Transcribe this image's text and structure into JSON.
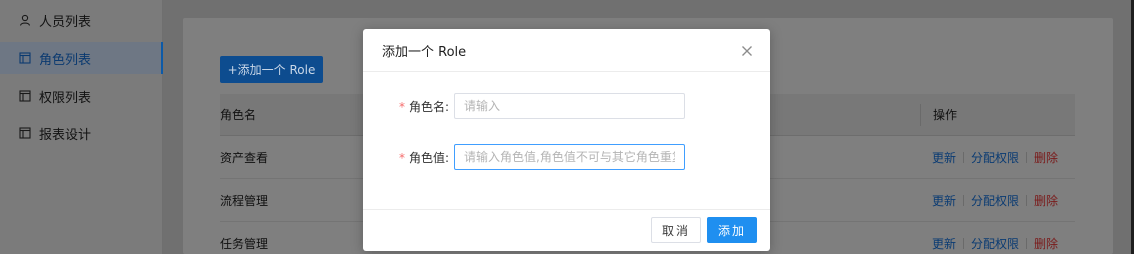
{
  "sidebar": {
    "items": [
      {
        "label": "人员列表",
        "icon": "user-icon",
        "active": false
      },
      {
        "label": "角色列表",
        "icon": "window-icon",
        "active": true
      },
      {
        "label": "权限列表",
        "icon": "window-icon",
        "active": false
      },
      {
        "label": "报表设计",
        "icon": "window-icon",
        "active": false
      }
    ]
  },
  "main": {
    "add_button_label": "+添加一个 Role",
    "table": {
      "headers": {
        "name": "角色名",
        "ops": "操作"
      },
      "rows": [
        {
          "name": "资产查看"
        },
        {
          "name": "流程管理"
        },
        {
          "name": "任务管理"
        }
      ],
      "ops": {
        "update": "更新",
        "assign": "分配权限",
        "delete": "删除"
      }
    }
  },
  "modal": {
    "title": "添加一个 Role",
    "fields": {
      "role_name": {
        "label": "角色名:",
        "required": "*",
        "placeholder": "请输入",
        "value": ""
      },
      "role_value": {
        "label": "角色值:",
        "required": "*",
        "placeholder": "请输入角色值,角色值不可与其它角色重复",
        "value": ""
      }
    },
    "cancel_label": "取消",
    "confirm_label": "添加"
  },
  "colors": {
    "primary": "#1f8ff0",
    "danger": "#f56c6c",
    "overlay": "#7f7f7f"
  }
}
